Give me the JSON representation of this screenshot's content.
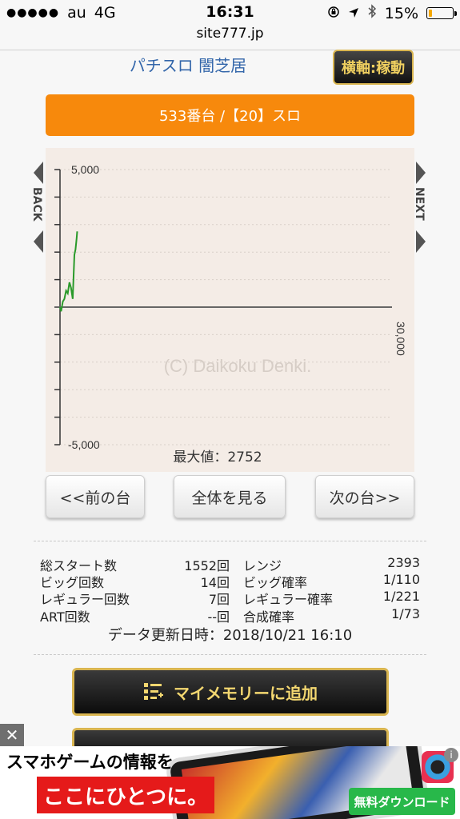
{
  "status_bar": {
    "signal_dots": "●●●●●",
    "carrier": "au",
    "network": "4G",
    "time": "16:31",
    "battery_percent": "15%",
    "battery_level": 0.15,
    "icons": [
      "orientation-lock-icon",
      "location-arrow-icon",
      "bluetooth-icon",
      "battery-icon"
    ]
  },
  "browser": {
    "url": "site777.jp"
  },
  "header": {
    "shop_name": "パチスロ 闇芝居",
    "axis_toggle_label": "横軸:稼動"
  },
  "machine": {
    "title": "533番台 /【20】スロ"
  },
  "nav": {
    "back_label": "BACK",
    "next_label": "NEXT"
  },
  "chart_data": {
    "type": "line",
    "y_tick_labels": [
      "5,000",
      "-5,000"
    ],
    "x_tick_labels": [
      "30,000"
    ],
    "ylim": [
      -5000,
      5000
    ],
    "xlim": [
      0,
      30000
    ],
    "watermark": "(C) Daikoku Denki.",
    "max_label": "最大値：2752",
    "grid": true,
    "color": "#2a9a2a",
    "series": [
      {
        "x": [
          0,
          100,
          250,
          400,
          550,
          700,
          850,
          1000,
          1150,
          1300,
          1400,
          1500,
          1552
        ],
        "y": [
          0,
          -150,
          200,
          300,
          600,
          500,
          900,
          700,
          300,
          1900,
          2100,
          2500,
          2752
        ]
      }
    ]
  },
  "buttons": {
    "prev": "<<前の台",
    "all": "全体を見る",
    "next": "次の台>>"
  },
  "stats": {
    "rows": [
      {
        "l_label": "総スタート数",
        "l_value": "1552回",
        "r_label": "レンジ",
        "r_value": "2393"
      },
      {
        "l_label": "ビッグ回数",
        "l_value": "14回",
        "r_label": "ビッグ確率",
        "r_value": "1/110"
      },
      {
        "l_label": "レギュラー回数",
        "l_value": "7回",
        "r_label": "レギュラー確率",
        "r_value": "1/221"
      },
      {
        "l_label": "ART回数",
        "l_value": "--回",
        "r_label": "合成確率",
        "r_value": "1/73"
      }
    ],
    "updated": "データ更新日時：2018/10/21 16:10"
  },
  "memory_button": {
    "label": "マイメモリーに追加",
    "icon": "list-add-icon"
  },
  "ad": {
    "close": "✕",
    "line1": "スマホゲームの情報を",
    "line2": "ここにひとつに。",
    "download": "無料ダウンロード",
    "info": "i"
  }
}
